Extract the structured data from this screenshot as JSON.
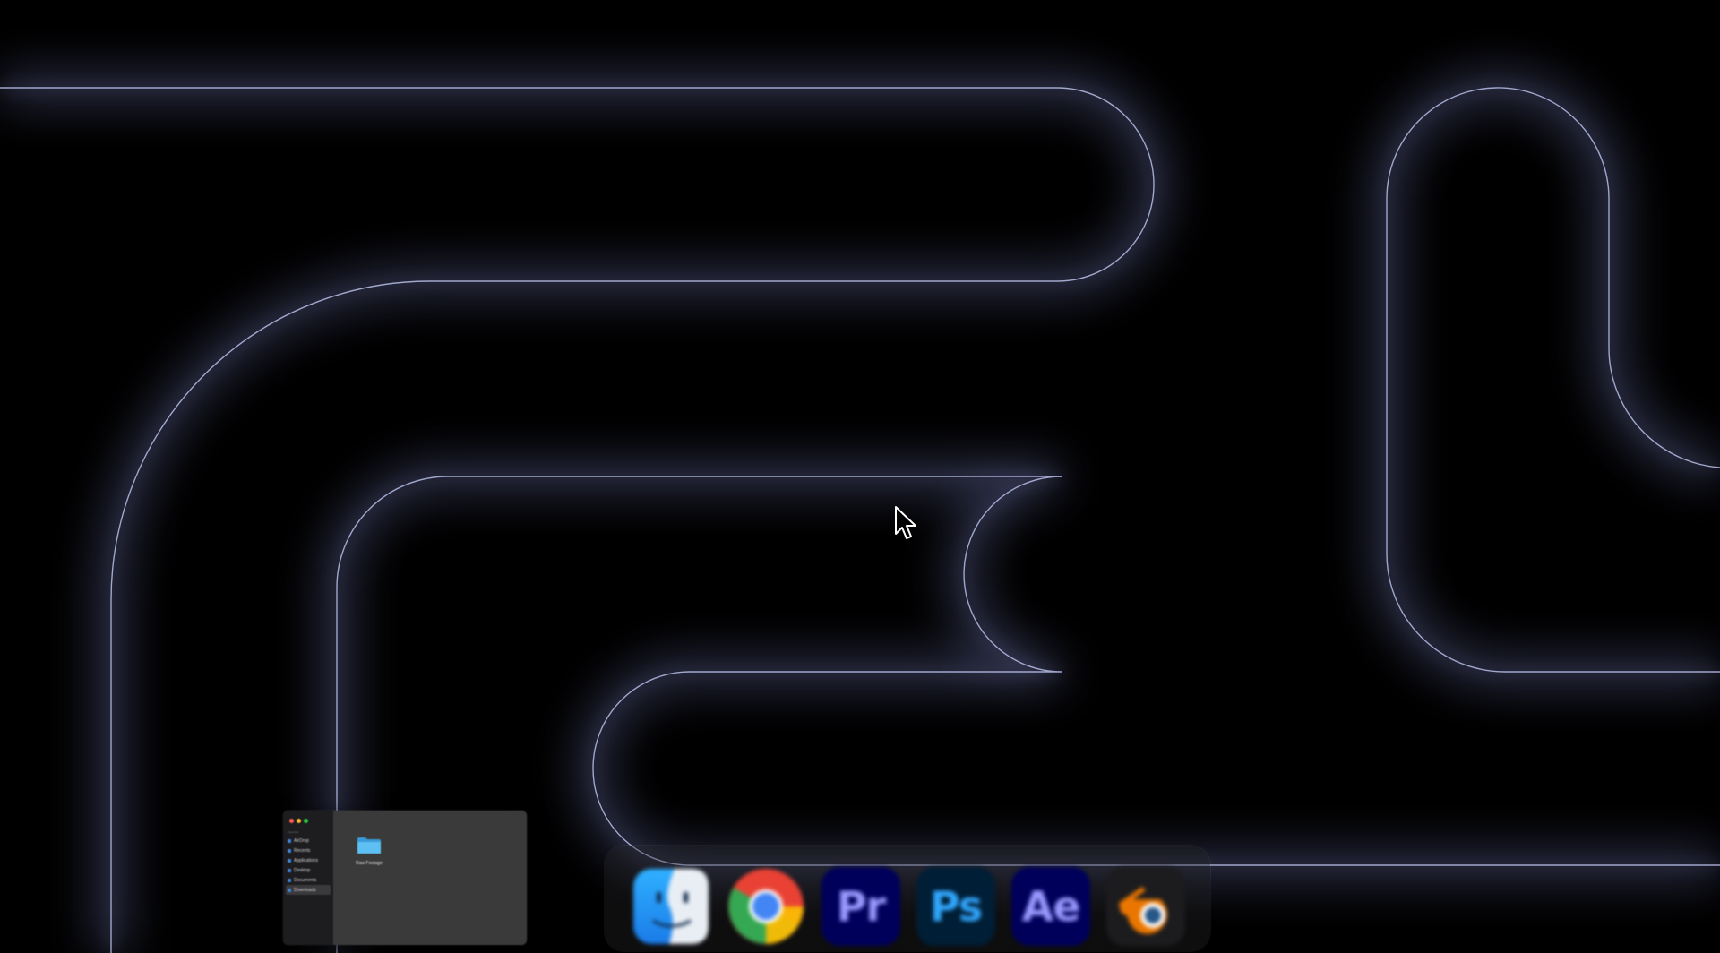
{
  "finder": {
    "sidebar_heading": "Favorites",
    "sidebar_items": [
      {
        "label": "AirDrop",
        "icon": "airdrop-icon"
      },
      {
        "label": "Recents",
        "icon": "clock-icon"
      },
      {
        "label": "Applications",
        "icon": "applications-icon"
      },
      {
        "label": "Desktop",
        "icon": "desktop-icon"
      },
      {
        "label": "Documents",
        "icon": "document-icon"
      },
      {
        "label": "Downloads",
        "icon": "download-icon",
        "selected": true
      }
    ],
    "folder": {
      "label": "Raw Footage",
      "icon": "folder-icon",
      "color": "#4fb3ec"
    }
  },
  "dock": {
    "items": [
      {
        "name": "Finder",
        "icon": "finder-icon"
      },
      {
        "name": "Google Chrome",
        "icon": "chrome-icon"
      },
      {
        "name": "Premiere Pro",
        "icon": "premiere-pro-icon",
        "text": "Pr",
        "bg": "#00005b",
        "fg": "#9999ff"
      },
      {
        "name": "Photoshop",
        "icon": "photoshop-icon",
        "text": "Ps",
        "bg": "#001e36",
        "fg": "#31a8ff"
      },
      {
        "name": "After Effects",
        "icon": "after-effects-icon",
        "text": "Ae",
        "bg": "#00005b",
        "fg": "#9999ff"
      },
      {
        "name": "Blender",
        "icon": "blender-icon"
      }
    ]
  },
  "wallpaper": {
    "style": "dark abstract ribbon",
    "glow_color": "#9aa2d8"
  }
}
